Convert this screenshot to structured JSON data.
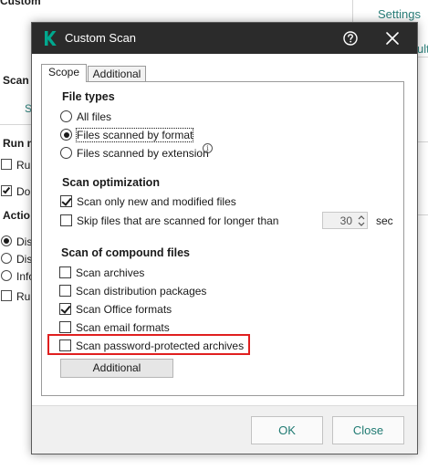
{
  "background": {
    "top_label": "Custom",
    "settings_link": "Settings",
    "right_fragment": "ult",
    "scan_heading": "Scan s",
    "s_link": "S",
    "run_heading": "Run m",
    "run_item_1": "Run",
    "do_item": "Do",
    "action_heading": "Actio",
    "dis_item_1": "Dis",
    "dis_item_2": "Dis",
    "info_item": "Info",
    "run_item_2": "Run"
  },
  "dialog": {
    "title": "Custom Scan",
    "tabs": [
      {
        "label": "Scope",
        "active": true
      },
      {
        "label": "Additional",
        "active": false
      }
    ],
    "file_types": {
      "heading": "File types",
      "options": [
        {
          "label": "All files",
          "selected": false
        },
        {
          "label": "Files scanned by format",
          "selected": true
        },
        {
          "label": "Files scanned by extension",
          "selected": false
        }
      ]
    },
    "scan_optimization": {
      "heading": "Scan optimization",
      "only_new": {
        "label": "Scan only new and modified files",
        "checked": true
      },
      "skip_long": {
        "label": "Skip files that are scanned for longer than",
        "checked": false
      },
      "skip_value": "30",
      "skip_unit": "sec"
    },
    "compound_files": {
      "heading": "Scan of compound files",
      "items": [
        {
          "label": "Scan archives",
          "checked": false
        },
        {
          "label": "Scan distribution packages",
          "checked": false
        },
        {
          "label": "Scan Office formats",
          "checked": true
        },
        {
          "label": "Scan email formats",
          "checked": false
        },
        {
          "label": "Scan password-protected archives",
          "checked": false
        }
      ],
      "additional_button": "Additional"
    },
    "footer": {
      "ok_label": "OK",
      "close_label": "Close"
    }
  },
  "colors": {
    "titlebar": "#2b2b2b",
    "brand_green": "#00a88e",
    "link_teal": "#1f7a72",
    "highlight_red": "#e01f1f"
  },
  "icons": {
    "app": "kaspersky-k-icon",
    "help": "help-circle-icon",
    "close": "close-x-icon",
    "info": "info-icon",
    "spin_up": "chevron-up-icon",
    "spin_down": "chevron-down-icon"
  }
}
